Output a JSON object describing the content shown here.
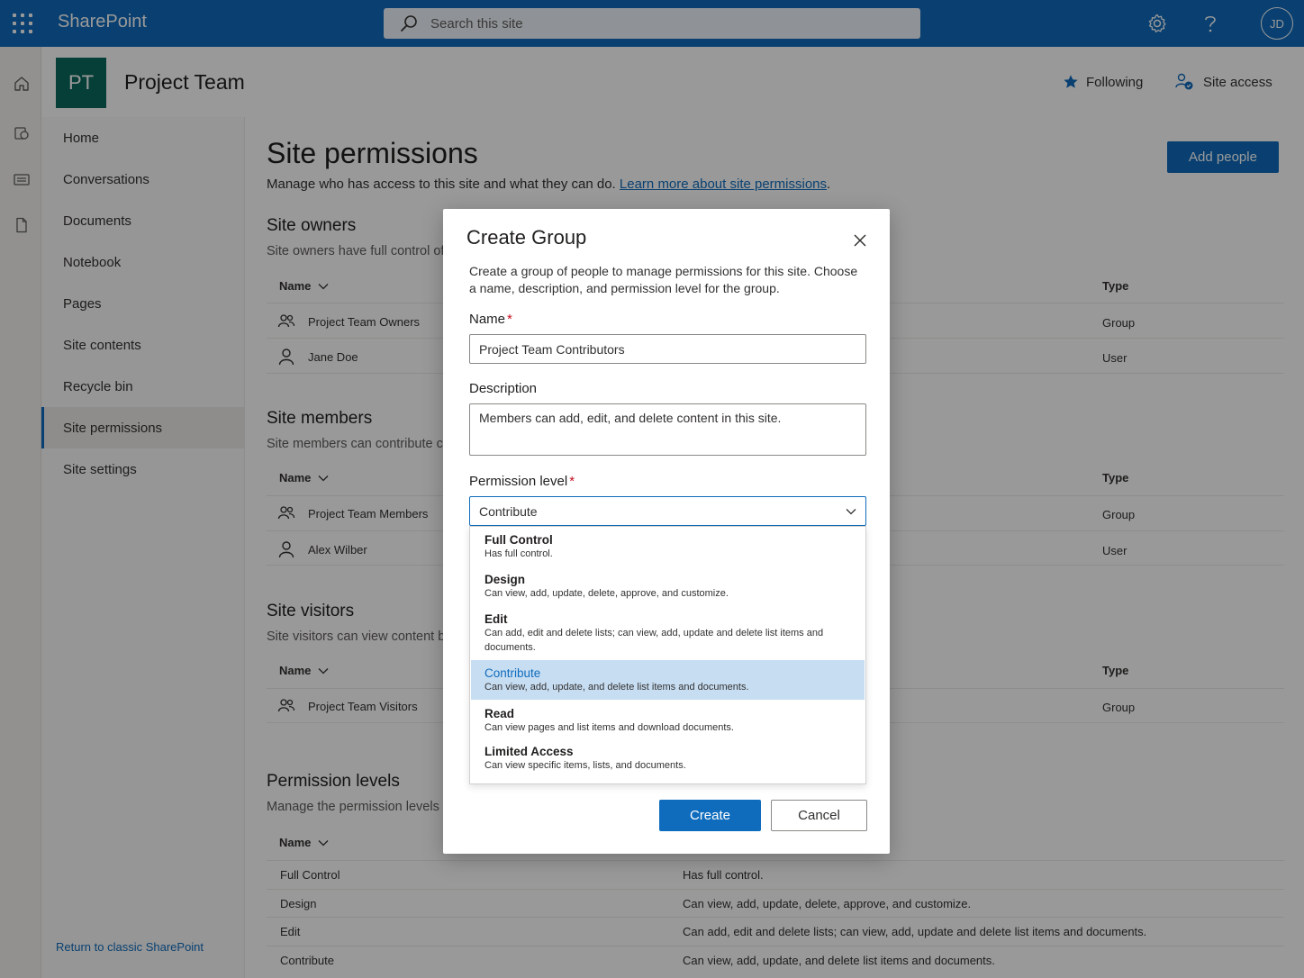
{
  "suite": {
    "app_name": "SharePoint",
    "search_placeholder": "Search this site",
    "avatar_initials": "JD",
    "icons": [
      "app-launcher-icon",
      "search-icon",
      "settings-gear-icon",
      "help-icon"
    ]
  },
  "site": {
    "logo_initials": "PT",
    "title": "Project Team",
    "following_label": "Following",
    "site_access_label": "Site access"
  },
  "nav": {
    "items": [
      {
        "label": "Home"
      },
      {
        "label": "Conversations"
      },
      {
        "label": "Documents"
      },
      {
        "label": "Notebook"
      },
      {
        "label": "Pages"
      },
      {
        "label": "Site contents"
      },
      {
        "label": "Recycle bin"
      },
      {
        "label": "Site permissions",
        "selected": true
      },
      {
        "label": "Site settings"
      }
    ],
    "classic_link": "Return to classic SharePoint"
  },
  "page": {
    "title": "Site permissions",
    "subtitle": "Manage who has access to this site and what they can do.",
    "learn_more": "Learn more about site permissions",
    "period": ".",
    "add_people": "Add people",
    "col_name": "Name",
    "col_type": "Type",
    "sections": {
      "owners": {
        "title": "Site owners",
        "desc": "Site owners have full control of",
        "rows": [
          {
            "name": "Project Team Owners",
            "type": "Group",
            "icon": "group-icon"
          },
          {
            "name": "Jane Doe",
            "type": "User",
            "icon": "person-icon"
          }
        ]
      },
      "members": {
        "title": "Site members",
        "desc": "Site members can contribute c",
        "rows": [
          {
            "name": "Project Team Members",
            "type": "Group",
            "icon": "group-icon"
          },
          {
            "name": "Alex Wilber",
            "type": "User",
            "icon": "person-icon"
          }
        ]
      },
      "visitors": {
        "title": "Site visitors",
        "desc": "Site visitors can view content b",
        "rows": [
          {
            "name": "Project Team Visitors",
            "type": "Group",
            "icon": "group-icon"
          }
        ]
      },
      "levels": {
        "title": "Permission levels",
        "desc": "Manage the permission levels a",
        "rows": [
          {
            "name": "Full Control",
            "desc": "Has full control."
          },
          {
            "name": "Design",
            "desc": "Can view, add, update, delete, approve, and customize."
          },
          {
            "name": "Edit",
            "desc": "Can add, edit and delete lists; can view, add, update and delete list items and documents."
          },
          {
            "name": "Contribute",
            "desc": "Can view, add, update, and delete list items and documents."
          }
        ]
      }
    }
  },
  "dialog": {
    "title": "Create Group",
    "description": "Create a group of people to manage permissions for this site. Choose a name, description, and permission level for the group.",
    "name_label": "Name",
    "name_value": "Project Team Contributors",
    "desc_label": "Description",
    "desc_value": "Members can add, edit, and delete content in this site.",
    "permission_label": "Permission level",
    "required_mark": "*",
    "selected_level": "Contribute",
    "options": [
      {
        "title": "Full Control",
        "desc": "Has full control."
      },
      {
        "title": "Design",
        "desc": "Can view, add, update, delete, approve, and customize."
      },
      {
        "title": "Edit",
        "desc": "Can add, edit and delete lists; can view, add, update and delete list items and documents."
      },
      {
        "title": "Contribute",
        "desc": "Can view, add, update, and delete list items and documents.",
        "selected": true
      },
      {
        "title": "Read",
        "desc": "Can view pages and list items and download documents."
      },
      {
        "title": "Limited Access",
        "desc": "Can view specific items, lists, and documents."
      }
    ],
    "create_label": "Create",
    "cancel_label": "Cancel"
  },
  "colors": {
    "brand": "#0f6cbd",
    "site_logo": "#0b6a5e",
    "selected_option": "#c7ddf2",
    "required": "#c50f1f"
  }
}
